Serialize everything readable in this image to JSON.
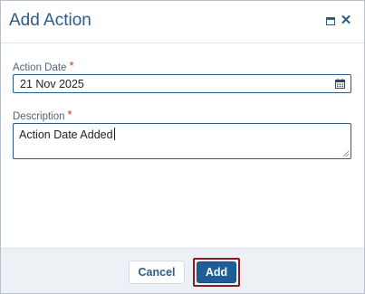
{
  "dialog": {
    "title": "Add Action",
    "maximize_icon": "maximize-icon",
    "close_icon": "close-icon"
  },
  "fields": {
    "action_date": {
      "label": "Action Date",
      "required_mark": "*",
      "value": "21 Nov 2025",
      "icon": "calendar-icon"
    },
    "description": {
      "label": "Description",
      "required_mark": "*",
      "value": "Action Date Added"
    }
  },
  "footer": {
    "cancel_label": "Cancel",
    "add_label": "Add"
  },
  "colors": {
    "accent": "#2b5d8a",
    "primary_button": "#1f5d96",
    "required": "#d9262b",
    "highlight_outline": "#8b1a24",
    "footer_bg": "#edf0f4"
  }
}
